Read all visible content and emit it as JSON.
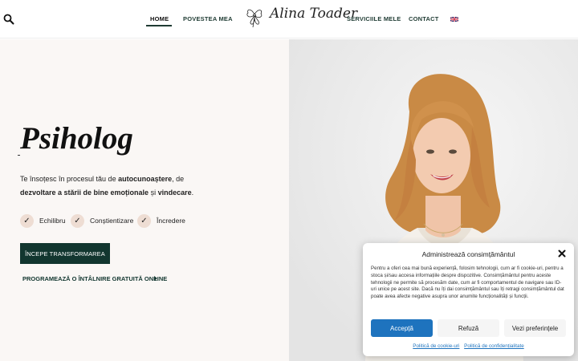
{
  "header": {
    "nav": {
      "home": "HOME",
      "story": "POVESTEA MEA",
      "services": "SERVICIILE MELE",
      "contact": "CONTACT"
    },
    "logo_text": "Alina Toader",
    "icons": {
      "search": "search-icon",
      "language": "uk-flag-icon"
    }
  },
  "hero": {
    "title": "Psiholog",
    "desc_parts": {
      "p1": "Te însoțesc în procesul tău de ",
      "b1": "autocunoaștere",
      "p2": ", de ",
      "b2": "dezvoltare a stării de bine emoționale",
      "p3": " și ",
      "b3": "vindecare",
      "p4": "."
    },
    "checks": [
      "Echilibru",
      "Conștientizare",
      "Încredere"
    ],
    "check_glyph": "✓",
    "cta": "ÎNCEPE TRANSFORMAREA",
    "free_link": "PROGRAMEAZĂ O ÎNTÂLNIRE GRATUITĂ ONLINE"
  },
  "consent": {
    "title": "Administrează consimțământul",
    "text": "Pentru a oferi cea mai bună experiență, folosim tehnologii, cum ar fi cookie-uri, pentru a stoca și/sau accesa informațiile despre dispozitive. Consimțământul pentru aceste tehnologii ne permite să procesăm date, cum ar fi comportamentul de navigare sau ID-uri unice pe acest site. Dacă nu îți dai consimțământul sau îți retragi consimțământul dat poate avea afecte negative asupra unor anumite funcționalități și funcții.",
    "accept": "Accepță",
    "refuse": "Refuză",
    "prefs": "Vezi preferințele",
    "cookie_policy": "Politică de cookie-uri",
    "privacy_policy": "Politică de confidențialitate"
  },
  "colors": {
    "brand_dark": "#12362f",
    "accent_blue": "#1e73be",
    "check_bg": "#eeddd3",
    "hero_bg": "#faf7f5"
  }
}
